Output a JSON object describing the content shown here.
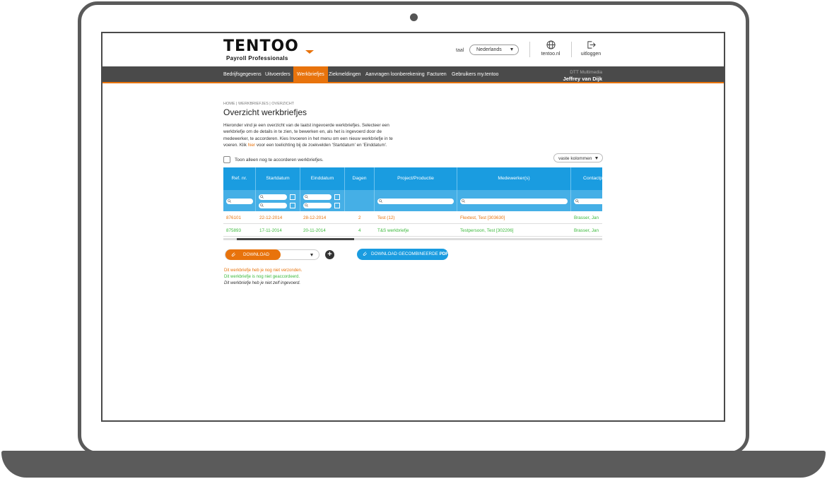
{
  "header": {
    "logo_main": "TENTOO",
    "logo_sub": "Payroll Professionals",
    "taal_label": "taal",
    "language": "Nederlands",
    "site_link": "tentoo.nl",
    "logout_link": "uitloggen"
  },
  "nav": {
    "items": [
      {
        "label": "Bedrijfsgegevens"
      },
      {
        "label": "Uitvoerders"
      },
      {
        "label": "Werkbriefjes"
      },
      {
        "label": "Ziekmeldingen"
      },
      {
        "label": "Aanvragen loonberekening"
      },
      {
        "label": "Facturen"
      },
      {
        "label": "Gebruikers my.tentoo"
      }
    ],
    "active": "Werkbriefjes",
    "company": "DTT Multimedia",
    "user": "Jeffrey van Dijk"
  },
  "page": {
    "breadcrumb": "HOME | WERKBRIEFJES | OVERZICHT",
    "title": "Overzicht werkbriefjes",
    "intro_1": "Hieronder vind je een overzicht van de laatst ingevoerde werkbriefjes. Selecteer een werkbriefje om de details in te zien, te bewerken en, als het is ingevoerd door de medewerker, te accorderen. Kies Invoeren in het menu om een nieuw werkbriefje in te voeren. Klik ",
    "intro_link": "hier",
    "intro_2": " voor een toelichting bij de zoekvelden 'Startdatum' en 'Einddatum'.",
    "checkbox_label": "Toon alleen nog te accorderen werkbriefjes.",
    "columns_button": "vaste kolommen"
  },
  "table": {
    "headers": [
      "Ref. nr.",
      "Startdatum",
      "Einddatum",
      "Dagen",
      "Project/Productie",
      "Medewerker(s)",
      "Contactp"
    ],
    "rows": [
      {
        "ref": "876101",
        "start": "22-12-2014",
        "end": "28-12-2014",
        "days": "2",
        "project": "Test (12)",
        "employee": "Flextest, Test [303630]",
        "contact": "Brasser, Jan",
        "status": "orange"
      },
      {
        "ref": "875893",
        "start": "17-11-2014",
        "end": "20-11-2014",
        "days": "4",
        "project": "T&S werkbriefje",
        "employee": "Testpersoon, Test [302206]",
        "contact": "Brasser, Jan",
        "status": "green"
      }
    ]
  },
  "actions": {
    "download": "DOWNLOAD",
    "plus": "+",
    "pdf_prefix": "DOWNLOAD GECOMBINEERDE ",
    "pdf_bold": "PDF"
  },
  "legend": {
    "not_sent": "Dit werkbriefje heb je nog niet verzonden.",
    "not_approved": "Dit werkbriefje is nog niet geaccordeerd.",
    "not_self": "Dit werkbriefje heb je niet zelf ingevoerd."
  },
  "colors": {
    "orange": "#e8730c",
    "blue": "#1a9ce0",
    "green": "#3cb93c",
    "nav": "#4a4a4a"
  }
}
